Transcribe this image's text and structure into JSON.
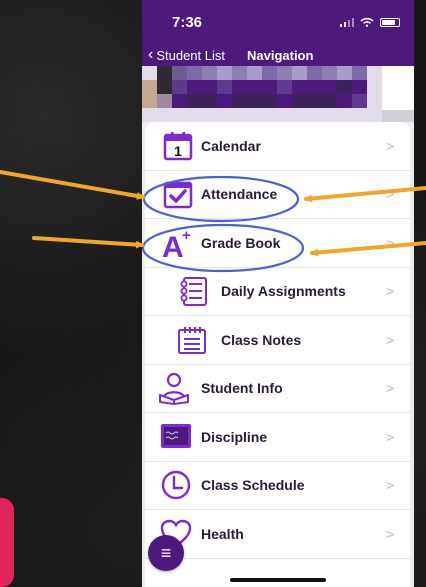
{
  "status_bar": {
    "time": "7:36"
  },
  "navbar": {
    "back_label": "Student List",
    "title": "Navigation"
  },
  "menu": {
    "items": [
      {
        "label": "Calendar",
        "calendar_day": "1"
      },
      {
        "label": "Attendance"
      },
      {
        "label": "Grade Book",
        "icon_glyph": "A",
        "icon_sup": "+"
      },
      {
        "label": "Daily Assignments"
      },
      {
        "label": "Class Notes"
      },
      {
        "label": "Student Info"
      },
      {
        "label": "Discipline"
      },
      {
        "label": "Class Schedule"
      },
      {
        "label": "Health"
      }
    ],
    "chevron": ">"
  },
  "fab": {
    "glyph": "≡"
  },
  "colors": {
    "purple": "#4b1a7c",
    "icon_purple": "#8a2be2",
    "annotation_arrow": "#f3a623",
    "annotation_circle": "#4a5fd8",
    "accent_pink": "#e2245a"
  }
}
